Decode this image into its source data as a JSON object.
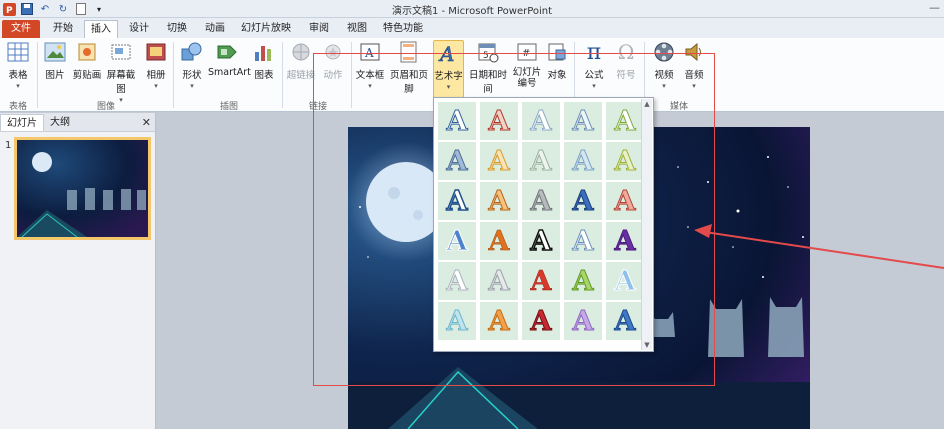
{
  "window": {
    "title": "演示文稿1 - Microsoft PowerPoint",
    "qat_icons": [
      "powerpoint-logo-icon",
      "save-icon",
      "undo-icon",
      "redo-icon",
      "blank-doc-icon",
      "customize-icon"
    ]
  },
  "tabs": [
    {
      "label": "文件"
    },
    {
      "label": "开始"
    },
    {
      "label": "插入"
    },
    {
      "label": "设计"
    },
    {
      "label": "切换"
    },
    {
      "label": "动画"
    },
    {
      "label": "幻灯片放映"
    },
    {
      "label": "审阅"
    },
    {
      "label": "视图"
    },
    {
      "label": "特色功能"
    }
  ],
  "ribbon": {
    "buttons": {
      "table": "表格",
      "picture": "图片",
      "clipart": "剪贴画",
      "screenshot": "屏幕截图",
      "album": "相册",
      "shapes": "形状",
      "smartart": "SmartArt",
      "chart": "图表",
      "hyperlink": "超链接",
      "action": "动作",
      "textbox": "文本框",
      "headerfooter": "页眉和页脚",
      "wordart": "艺术字",
      "datetime": "日期和时间",
      "slidenum": "幻灯片\n编号",
      "object": "对象",
      "equation": "公式",
      "symbol": "符号",
      "video": "视频",
      "audio": "音频"
    },
    "groups": {
      "tables": "表格",
      "images": "图像",
      "illustrations": "插图",
      "links": "链接",
      "media": "媒体"
    }
  },
  "panel": {
    "tabs": [
      "幻灯片",
      "大纲"
    ],
    "slide_number": "1"
  },
  "accent": {
    "file_tab": "#d24726",
    "selected_button": "#fde8a3",
    "annotation_red": "#e34a4a"
  }
}
